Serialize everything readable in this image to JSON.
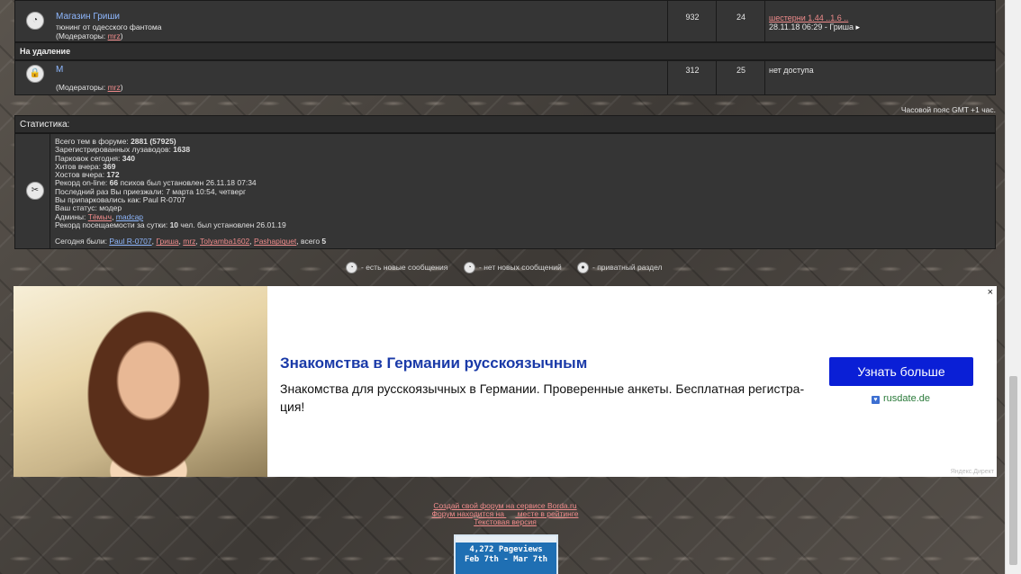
{
  "forum_rows": [
    {
      "title": "Магазин Гриши",
      "description": "тюнинг от одесского фантома",
      "moderators_prefix": "(Модераторы: ",
      "moderator": "mrz",
      "moderators_suffix": ")",
      "topics": "932",
      "posts": "24",
      "last_post_link": "шестерни 1.44 ..1.6 ..",
      "last_post_meta": "28.11.18 06:29 - Гриша"
    }
  ],
  "section_deleted": {
    "title": "На удаление",
    "row": {
      "title": "М",
      "moderators_prefix": "(Модераторы: ",
      "moderator": "mrz",
      "moderators_suffix": ")",
      "topics": "312",
      "posts": "25",
      "last_post": "нет доступа"
    }
  },
  "timezone": "Часовой пояс GMT +1 час.",
  "stats": {
    "title": "Статистика:",
    "lines": [
      {
        "label": "Всего тем в форуме: ",
        "value": "2881 (57925)"
      },
      {
        "label": "Зарегистрированных лузаводов: ",
        "value": "1638"
      },
      {
        "label": "Парковок сегодня: ",
        "value": "340"
      },
      {
        "label": "Хитов вчера: ",
        "value": "369"
      },
      {
        "label": "Хостов вчера: ",
        "value": "172"
      }
    ],
    "record_online_label": "Рекорд on-line: ",
    "record_online_value": "66",
    "record_online_rest": " психов был установлен 26.11.18 07:34",
    "last_visit": "Последний раз Вы приезжали: 7 марта 10:54, четверг",
    "logged_as": "Вы припарковались как: Paul R-0707",
    "status": "Ваш статус: модер",
    "admins_label": "Админы: ",
    "admins": [
      "Тёмыч",
      "madcap"
    ],
    "record_day_label": "Рекорд посещаемости за сутки: ",
    "record_day_value": "10",
    "record_day_rest": " чел. был установлен 26.01.19",
    "today_label": "Сегодня были: ",
    "today_users": [
      "Paul R-0707",
      "Гриша",
      "mrz",
      "Tolyamba1602",
      "Pashapiquet"
    ],
    "today_total_label": ", всего ",
    "today_total": "5"
  },
  "legend": [
    "- есть новые сообщения",
    "- нет новых сообщений",
    "- приватный раздел"
  ],
  "ad": {
    "title": "Знакомства в Германии русскоязычным",
    "text": "Знакомства для русскоязычных в Германии. Проверенные анкеты. Бесплатная регистра-ция!",
    "button": "Узнать больше",
    "domain": "rusdate.de",
    "close": "×",
    "label": "Яндекс.Директ"
  },
  "footer": {
    "create_forum": "Создай свой форум на сервисе Borda.ru",
    "rating_prefix": "Форум находится на ",
    "rating_suffix": " месте в рейтинге",
    "text_version": "Текстовая версия"
  },
  "counter": {
    "pageviews": "4,272 Pageviews",
    "range": "Feb 7th - Mar 7th"
  },
  "colors": {
    "link_red": "#f08c8c",
    "link_blue": "#8fb8ff",
    "ad_button": "#0a1fd6",
    "ad_title": "#1a3aa8",
    "counter_bg": "#1f6fb3"
  }
}
